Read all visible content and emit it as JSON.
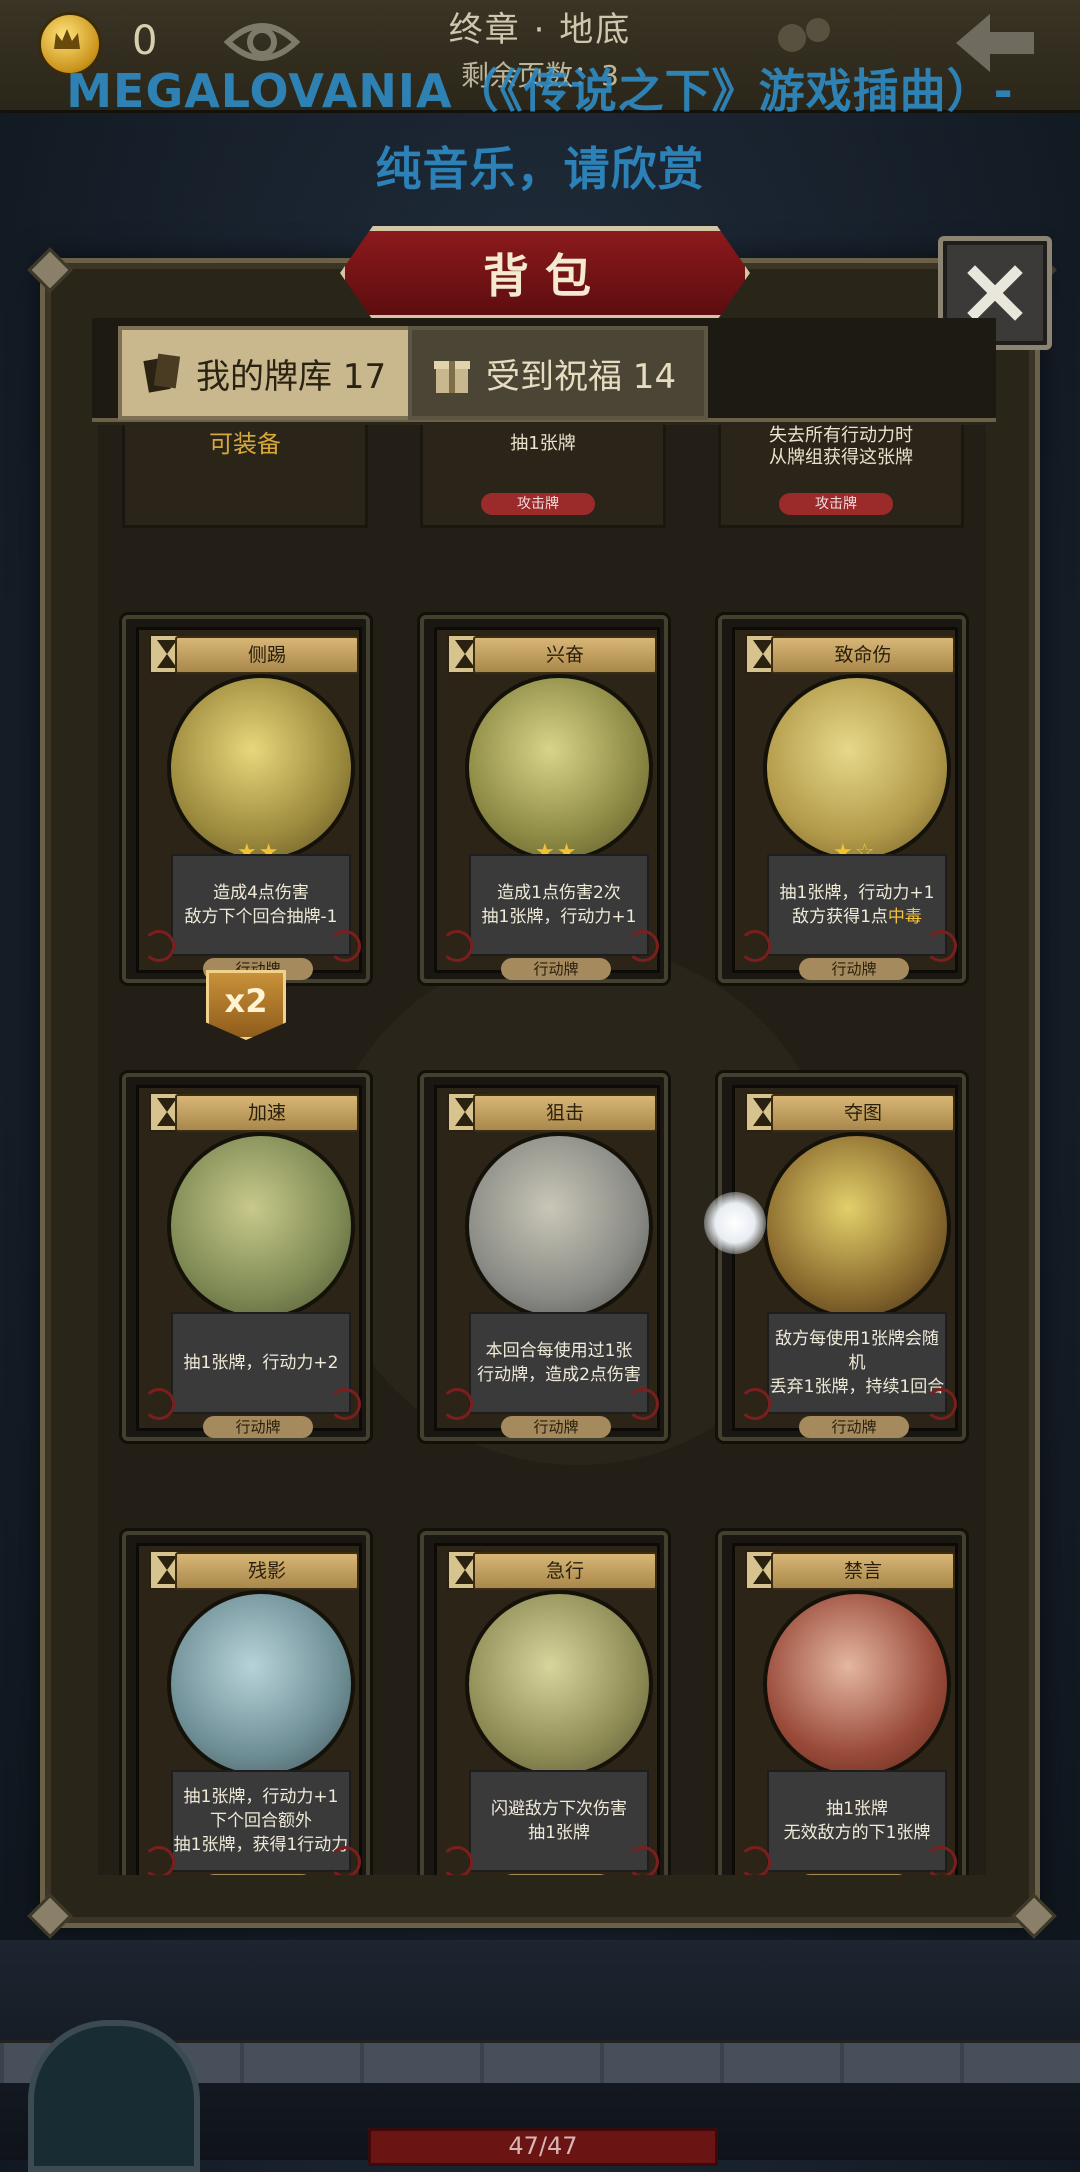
{
  "topbar": {
    "coin_count": "0",
    "chapter": "终章 · 地底",
    "pages_left": "剩余页数：3"
  },
  "overlay_title_line1": "MEGALOVANIA（《传说之下》游戏插曲）-",
  "overlay_title_line2": "纯音乐，请欣赏",
  "panel": {
    "title": "背包",
    "tabs": [
      {
        "label": "我的牌库 17",
        "active": true
      },
      {
        "label": "受到祝福 14",
        "active": false
      }
    ]
  },
  "partial_row": [
    {
      "lines": [
        "可装备"
      ]
    },
    {
      "lines": [
        "抽1张牌"
      ],
      "tag": "攻击牌"
    },
    {
      "lines": [
        "失去所有行动力时",
        "从牌组获得这张牌"
      ],
      "tag": "攻击牌"
    }
  ],
  "cards": [
    {
      "name": "侧踢",
      "stars": "★★",
      "desc": [
        "造成4点伤害",
        "敌方下个回合抽牌-1"
      ],
      "type": "行动牌"
    },
    {
      "name": "兴奋",
      "stars": "★★",
      "desc": [
        "造成1点伤害2次",
        "抽1张牌，行动力+1"
      ],
      "type": "行动牌"
    },
    {
      "name": "致命伤",
      "stars": "★☆",
      "desc": [
        "抽1张牌，行动力+1",
        "敌方获得1点"
      ],
      "desc_highlight": "中毒",
      "type": "行动牌"
    },
    {
      "name": "加速",
      "stars": "",
      "desc": [
        "抽1张牌，行动力+2"
      ],
      "type": "行动牌"
    },
    {
      "name": "狙击",
      "stars": "",
      "desc": [
        "本回合每使用过1张",
        "行动牌，造成2点伤害"
      ],
      "type": "行动牌"
    },
    {
      "name": "夺图",
      "stars": "",
      "desc": [
        "敌方每使用1张牌会随机",
        "丢弃1张牌，持续1回合"
      ],
      "type": "行动牌"
    },
    {
      "name": "残影",
      "stars": "",
      "desc": [
        "抽1张牌，行动力+1",
        "下个回合额外",
        "抽1张牌，获得1行动力"
      ],
      "type": "行动牌"
    },
    {
      "name": "急行",
      "stars": "",
      "desc": [
        "闪避敌方下次伤害",
        "抽1张牌"
      ],
      "type": "行动牌"
    },
    {
      "name": "禁言",
      "stars": "",
      "desc": [
        "抽1张牌",
        "无效敌方的下1张牌"
      ],
      "type": "行动牌"
    }
  ],
  "badge": "x2",
  "hp": "47/47",
  "icons": {
    "coin": "crown-coin-icon",
    "eye": "eye-icon",
    "back": "back-arrow-icon",
    "close": "close-icon",
    "deck": "deck-icon",
    "gift": "gift-icon",
    "hourglass": "hourglass-icon"
  },
  "colors": {
    "title_red": "#8c1a1c",
    "overlay_blue": "#2f8ec9",
    "tab_active": "#c9b88e",
    "highlight": "#f2c23c"
  }
}
